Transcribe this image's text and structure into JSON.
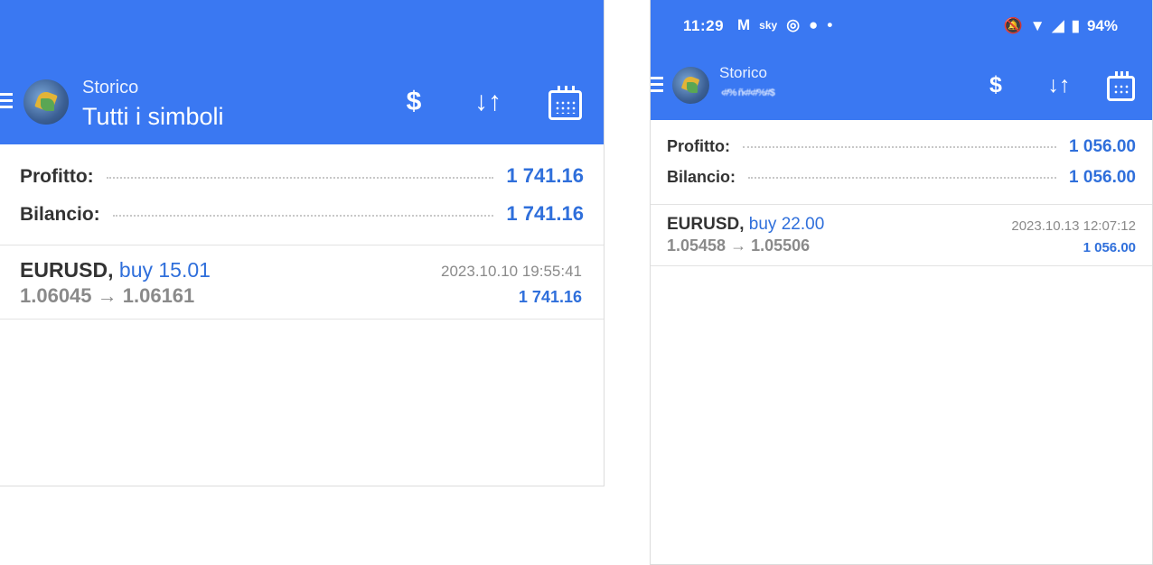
{
  "left": {
    "header": {
      "subtitle": "Storico",
      "title": "Tutti i simboli"
    },
    "icons": {
      "deposit": "$",
      "sort": "↓↑",
      "calendar": "calendar-icon"
    },
    "summary": {
      "profit_label": "Profitto:",
      "profit_value": "1 741.16",
      "balance_label": "Bilancio:",
      "balance_value": "1 741.16"
    },
    "deal": {
      "symbol": "EURUSD,",
      "direction": "buy 15.01",
      "prices": "1.06045 → 1.06161",
      "time": "2023.10.10 19:55:41",
      "profit": "1 741.16"
    }
  },
  "right": {
    "status": {
      "time": "11:29",
      "battery": "94%",
      "apps": [
        "M",
        "sky",
        "◎",
        "●",
        "•"
      ]
    },
    "header": {
      "subtitle": "Storico",
      "account_masked": "‹#%  ñ‹#‹#%#$"
    },
    "icons": {
      "deposit": "$",
      "sort": "↓↑",
      "calendar": "calendar-icon"
    },
    "summary": {
      "profit_label": "Profitto:",
      "profit_value": "1 056.00",
      "balance_label": "Bilancio:",
      "balance_value": "1 056.00"
    },
    "deal": {
      "symbol": "EURUSD,",
      "direction": "buy 22.00",
      "prices": "1.05458 → 1.05506",
      "time": "2023.10.13 12:07:12",
      "profit": "1 056.00"
    }
  },
  "colors": {
    "appbar": "#3a78f2",
    "accent": "#2f6fdb"
  }
}
